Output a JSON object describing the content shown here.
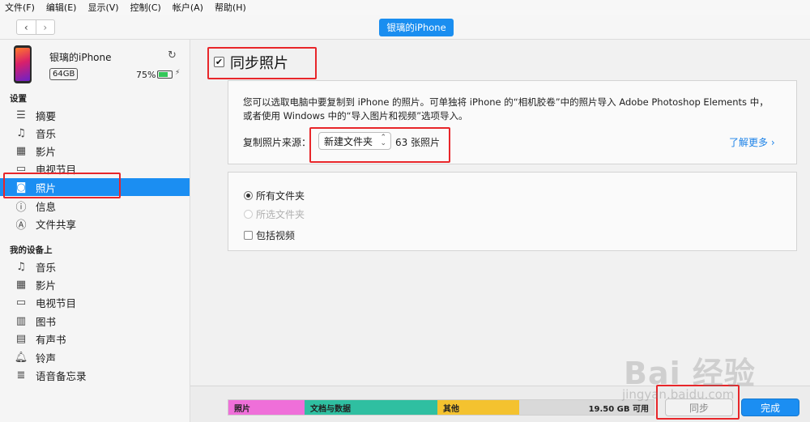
{
  "menu": [
    "文件(F)",
    "编辑(E)",
    "显示(V)",
    "控制(C)",
    "帐户(A)",
    "帮助(H)"
  ],
  "toolbar": {
    "back": "‹",
    "forward": "›",
    "device_pill": "银璃的iPhone"
  },
  "device": {
    "name": "银璃的iPhone",
    "capacity": "64GB",
    "battery_pct": "75%",
    "battery_level": 0.75
  },
  "sidebar": {
    "settings_header": "设置",
    "settings_items": [
      {
        "label": "摘要",
        "icon": "summary-icon"
      },
      {
        "label": "音乐",
        "icon": "music-icon"
      },
      {
        "label": "影片",
        "icon": "film-icon"
      },
      {
        "label": "电视节目",
        "icon": "tv-icon"
      },
      {
        "label": "照片",
        "icon": "camera-icon"
      },
      {
        "label": "信息",
        "icon": "info-icon"
      },
      {
        "label": "文件共享",
        "icon": "app-store-icon"
      }
    ],
    "ondevice_header": "我的设备上",
    "ondevice_items": [
      {
        "label": "音乐",
        "icon": "music-icon"
      },
      {
        "label": "影片",
        "icon": "film-icon"
      },
      {
        "label": "电视节目",
        "icon": "tv-icon"
      },
      {
        "label": "图书",
        "icon": "book-icon"
      },
      {
        "label": "有声书",
        "icon": "audiobook-icon"
      },
      {
        "label": "铃声",
        "icon": "bell-icon"
      },
      {
        "label": "语音备忘录",
        "icon": "voice-memo-icon"
      }
    ]
  },
  "main": {
    "title": "同步照片",
    "description": "您可以选取电脑中要复制到 iPhone 的照片。可单独将 iPhone 的“相机胶卷”中的照片导入 Adobe Photoshop Elements 中，或者使用 Windows 中的“导入图片和视频”选项导入。",
    "source_label": "复制照片来源：",
    "source_value": "新建文件夹",
    "photo_count": "63 张照片",
    "learn_more": "了解更多",
    "options": {
      "all_folders": "所有文件夹",
      "selected_folders": "所选文件夹",
      "include_videos": "包括视频"
    }
  },
  "storage": {
    "segments": [
      {
        "label": "照片",
        "color": "#ef6fd9"
      },
      {
        "label": "文档与数据",
        "color": "#2fbfa1"
      },
      {
        "label": "其他",
        "color": "#f4c22f"
      }
    ],
    "free": "19.50 GB 可用"
  },
  "buttons": {
    "sync": "同步",
    "done": "完成"
  },
  "watermark": {
    "logo": "Bai 经验",
    "sub": "jingyan.baidu.com"
  },
  "colors": {
    "accent": "#1b8ef2",
    "highlight": "#e8262a"
  }
}
